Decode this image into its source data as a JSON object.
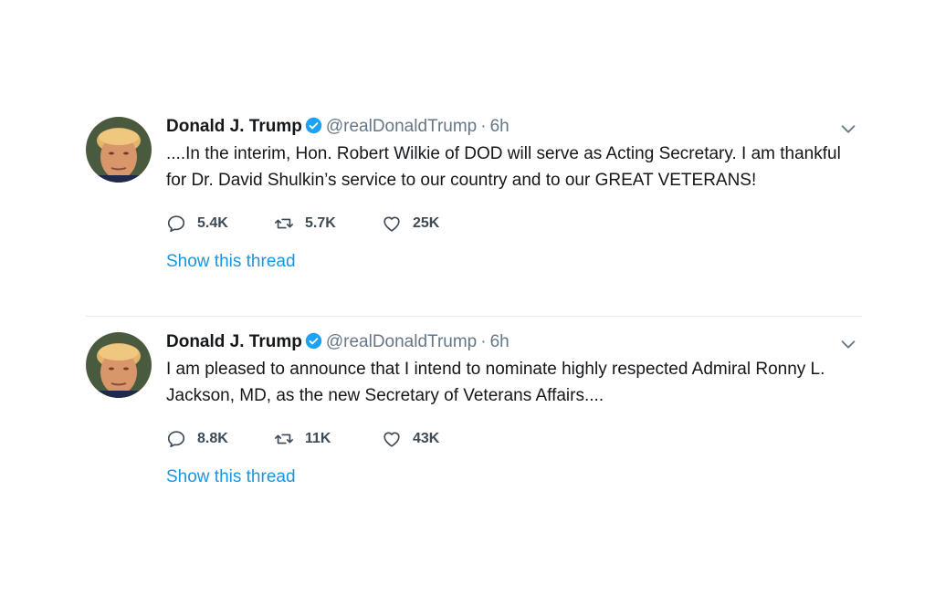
{
  "tweets": [
    {
      "name": "Donald J. Trump",
      "handle": "@realDonaldTrump",
      "separator": "·",
      "time": "6h",
      "text": "....In the interim, Hon. Robert Wilkie of DOD will serve as Acting Secretary. I am thankful for Dr. David Shulkin’s service to our country and to our GREAT VETERANS!",
      "replies": "5.4K",
      "retweets": "5.7K",
      "likes": "25K",
      "show_thread": "Show this thread"
    },
    {
      "name": "Donald J. Trump",
      "handle": "@realDonaldTrump",
      "separator": "·",
      "time": "6h",
      "text": "I am pleased to announce that I intend to nominate highly respected Admiral Ronny L. Jackson, MD, as the new Secretary of Veterans Affairs....",
      "replies": "8.8K",
      "retweets": "11K",
      "likes": "43K",
      "show_thread": "Show this thread"
    }
  ],
  "colors": {
    "text": "#14171a",
    "secondary": "#657786",
    "link": "#1b95e0",
    "verified": "#1da1f2",
    "divider": "#e6ecf0"
  },
  "icons": {
    "verified": "verified-badge-icon",
    "menu": "chevron-down-icon",
    "reply": "reply-icon",
    "retweet": "retweet-icon",
    "like": "heart-icon"
  }
}
